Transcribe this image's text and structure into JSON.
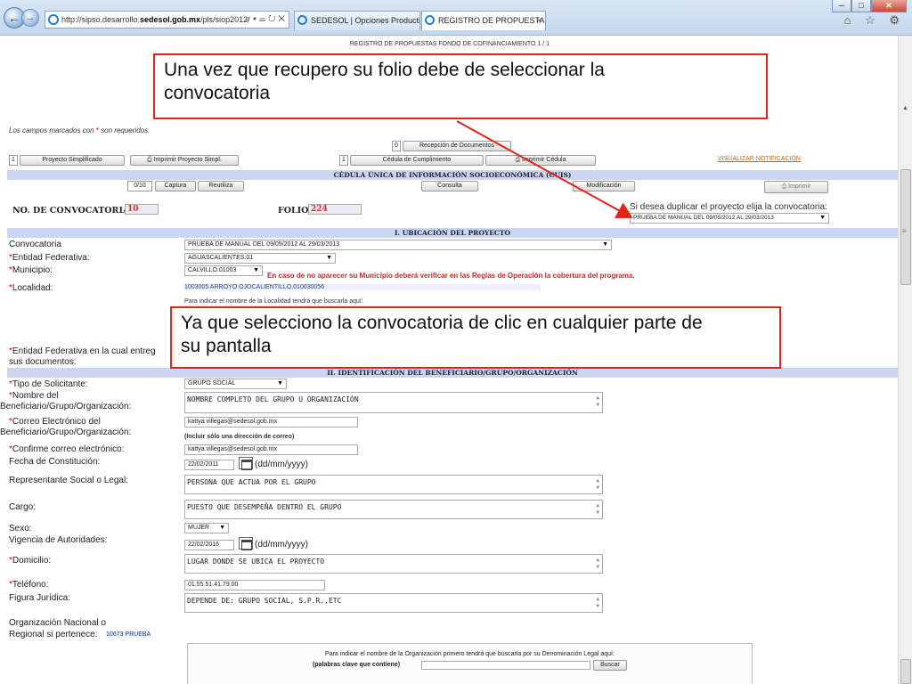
{
  "browser": {
    "back_icon": "back-arrow-icon",
    "forward_icon": "forward-arrow-icon",
    "url_prefix": "http://sipso.desarrollo.",
    "url_domain": "sedesol.gob.mx",
    "url_suffix": "/pls/siop2012/",
    "url_tools": "⌕ ▾ ☰ ↻ ✕",
    "tab1_title": "SEDESOL | Opciones Productivas",
    "tab2_title": "REGISTRO DE PROPUESTAS ...",
    "tab2_close": "×",
    "right_icons": "⌂ ☆ ⚙",
    "window_buttons": {
      "min": "─",
      "max": "□",
      "close": "✕"
    }
  },
  "page": {
    "title": "REGISTRO DE PROPUESTAS FONDO DE COFINANCIAMIENTO 1 / 1",
    "required_note_prefix": "Los campos marcados con ",
    "required_star": "*",
    "required_note_suffix": " son requeridos."
  },
  "toolbar": {
    "recepcion_count": "0",
    "recepcion_label": "Recepción de Documentos",
    "proyecto_count": "1",
    "proyecto_simplificado": "Proyecto Simplificado",
    "imprimir_proyecto": "⎙ Imprimir Proyecto Simpl.",
    "cedula_count": "1",
    "cedula_cumplimiento": "Cédula de Cumplimiento",
    "imprimir_cedula": "⎙ Imprimir Cédula",
    "visualizar": "VISUALIZAR NOTIFICACIÓN",
    "captura_count": "0/10",
    "captura": "Captura",
    "reutiliza": "Reutiliza",
    "consulta": "Consulta",
    "modificacion": "Modificación",
    "imprimir": "⎙ Imprimir"
  },
  "cuis_header": "CÉDULA ÚNICA DE INFORMACIÓN SOCIOECONÓMICA (CUIS)",
  "convocatoria": {
    "no_label": "NO. DE CONVOCATORIA:",
    "no_value": "10",
    "folio_label": "FOLIO:",
    "folio_value": "224",
    "duplicar_text": "Si desea duplicar el proyecto elija la convocatoria:",
    "duplicar_value": "PRUEBA DE MANUAL DEL 09/05/2012 AL 29/03/2013"
  },
  "section1": {
    "header": "I. UBICACIÓN DEL PROYECTO",
    "convocatoria_label": "Convocatoria",
    "convocatoria_value": "PRUEBA DE MANUAL DEL 09/05/2012 AL 29/03/2013",
    "entidad_label": "Entidad Federativa:",
    "entidad_value": "AGUASCALIENTES.01",
    "municipio_label": "Municipio:",
    "municipio_value": "CALVILLO.01003",
    "municipio_note": "En caso de no aparecer su Municipio deberá verificar en las Reglas de Operación la cobertura del programa.",
    "localidad_label": "Localidad:",
    "localidad_value": "1003005 ARROYO OJOCALIENTILLO.010030056",
    "localidad_hint": "Para indicar el nombre de la Localidad tendrá que buscarla aquí:",
    "entidad_entrega_label_1": "Entidad Federativa en la cual entreg",
    "entidad_entrega_label_2": "sus documentos:"
  },
  "section2": {
    "header": "II. IDENTIFICACIÓN DEL BENEFICIARIO/GRUPO/ORGANIZACIÓN",
    "tipo_label": "Tipo de Solicitante:",
    "tipo_value": "GRUPO SOCIAL",
    "nombre_label_1": "Nombre del",
    "nombre_label_2": "Beneficiario/Grupo/Organización:",
    "nombre_value": "NOMBRE COMPLETO DEL GRUPO U ORGANIZACIÓN",
    "correo_label_1": "Correo Electrónico del",
    "correo_label_2": "Beneficiario/Grupo/Organización:",
    "correo_value": "kattya.villegas@sedesol.gob.mx",
    "correo_hint": "(Incluir sólo una dirección de correo)",
    "confirme_label": "Confirme correo electrónico:",
    "confirme_value": "kattya.villegas@sedesol.gob.mx",
    "fecha_label": "Fecha de Constitución:",
    "fecha_value": "22/02/2011",
    "fecha_fmt": "(dd/mm/yyyy)",
    "representante_label": "Representante Social o Legal:",
    "representante_value": "PERSONA QUE ACTUA POR EL GRUPO",
    "cargo_label": "Cargo:",
    "cargo_value": "PUESTO QUE DESEMPEÑA DENTRO EL GRUPO",
    "sexo_label": "Sexo:",
    "sexo_value": "MUJER",
    "vigencia_label": "Vigencia de Autoridades:",
    "vigencia_value": "22/02/2016",
    "vigencia_fmt": "(dd/mm/yyyy)",
    "domicilio_label": "Domicilio:",
    "domicilio_value": "LUGAR DONDE SE UBICA EL PROYECTO",
    "telefono_label": "Teléfono:",
    "telefono_value": "01.55.51.41.79.00",
    "figura_label": "Figura Jurídica:",
    "figura_value": "DEPENDE DE: GRUPO SOCIAL, S.P.R.,ETC",
    "organizacion_label_1": "Organización Nacional o",
    "organizacion_label_2": "Regional si pertenece:",
    "organizacion_value": "10673  PRUEBA"
  },
  "search_box": {
    "text": "Para indicar el nombre de la Organización primero tendrá que buscarla por su Denominación Legal aquí:",
    "keywords": "(palabras clave que contiene)",
    "buscar": "Buscar"
  },
  "callouts": {
    "c1_line1": "Una vez que recupero su folio debe de seleccionar la",
    "c1_line2": "convocatoria",
    "c2_line1": "Ya que selecciono la convocatoria de clic en cualquier parte de",
    "c2_line2": "su pantalla"
  },
  "colors": {
    "callout_border": "#e1231b",
    "section_bar": "#ccd6f2",
    "required_star": "#dd0000"
  }
}
